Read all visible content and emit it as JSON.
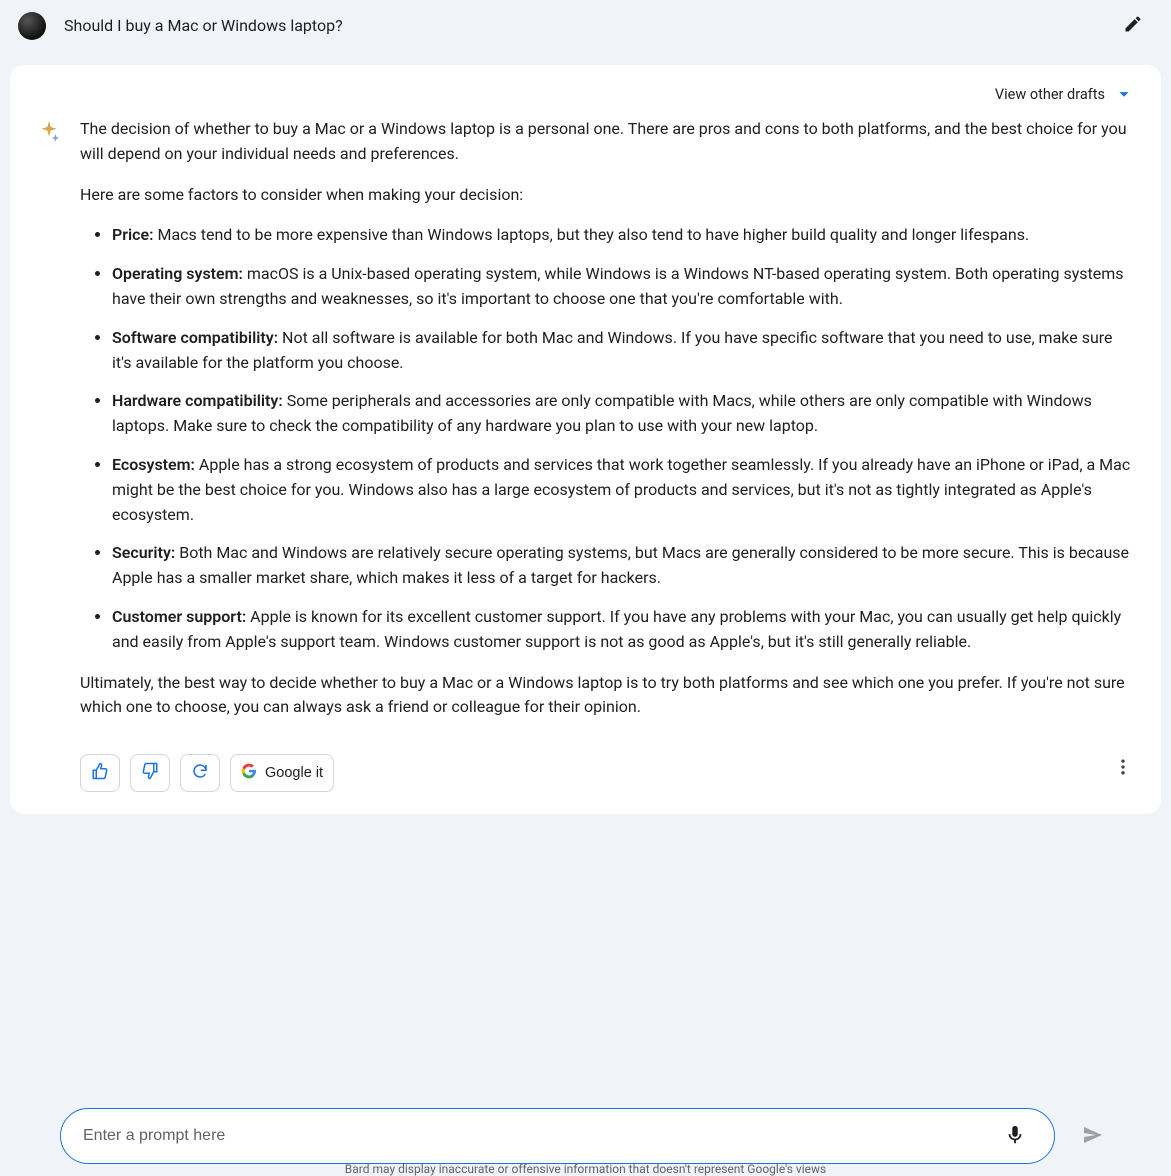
{
  "prompt": "Should I buy a Mac or Windows laptop?",
  "drafts_label": "View other drafts",
  "response": {
    "intro": "The decision of whether to buy a Mac or a Windows laptop is a personal one. There are pros and cons to both platforms, and the best choice for you will depend on your individual needs and preferences.",
    "lead": "Here are some factors to consider when making your decision:",
    "factors": [
      {
        "label": "Price:",
        "text": " Macs tend to be more expensive than Windows laptops, but they also tend to have higher build quality and longer lifespans."
      },
      {
        "label": "Operating system:",
        "text": " macOS is a Unix-based operating system, while Windows is a Windows NT-based operating system. Both operating systems have their own strengths and weaknesses, so it's important to choose one that you're comfortable with."
      },
      {
        "label": "Software compatibility:",
        "text": " Not all software is available for both Mac and Windows. If you have specific software that you need to use, make sure it's available for the platform you choose."
      },
      {
        "label": "Hardware compatibility:",
        "text": " Some peripherals and accessories are only compatible with Macs, while others are only compatible with Windows laptops. Make sure to check the compatibility of any hardware you plan to use with your new laptop."
      },
      {
        "label": "Ecosystem:",
        "text": " Apple has a strong ecosystem of products and services that work together seamlessly. If you already have an iPhone or iPad, a Mac might be the best choice for you. Windows also has a large ecosystem of products and services, but it's not as tightly integrated as Apple's ecosystem."
      },
      {
        "label": "Security:",
        "text": " Both Mac and Windows are relatively secure operating systems, but Macs are generally considered to be more secure. This is because Apple has a smaller market share, which makes it less of a target for hackers."
      },
      {
        "label": "Customer support:",
        "text": " Apple is known for its excellent customer support. If you have any problems with your Mac, you can usually get help quickly and easily from Apple's support team. Windows customer support is not as good as Apple's, but it's still generally reliable."
      }
    ],
    "outro": "Ultimately, the best way to decide whether to buy a Mac or a Windows laptop is to try both platforms and see which one you prefer. If you're not sure which one to choose, you can always ask a friend or colleague for their opinion."
  },
  "actions": {
    "google_it": "Google it"
  },
  "input": {
    "placeholder": "Enter a prompt here"
  },
  "disclaimer": "Bard may display inaccurate or offensive information that doesn't represent Google's views"
}
